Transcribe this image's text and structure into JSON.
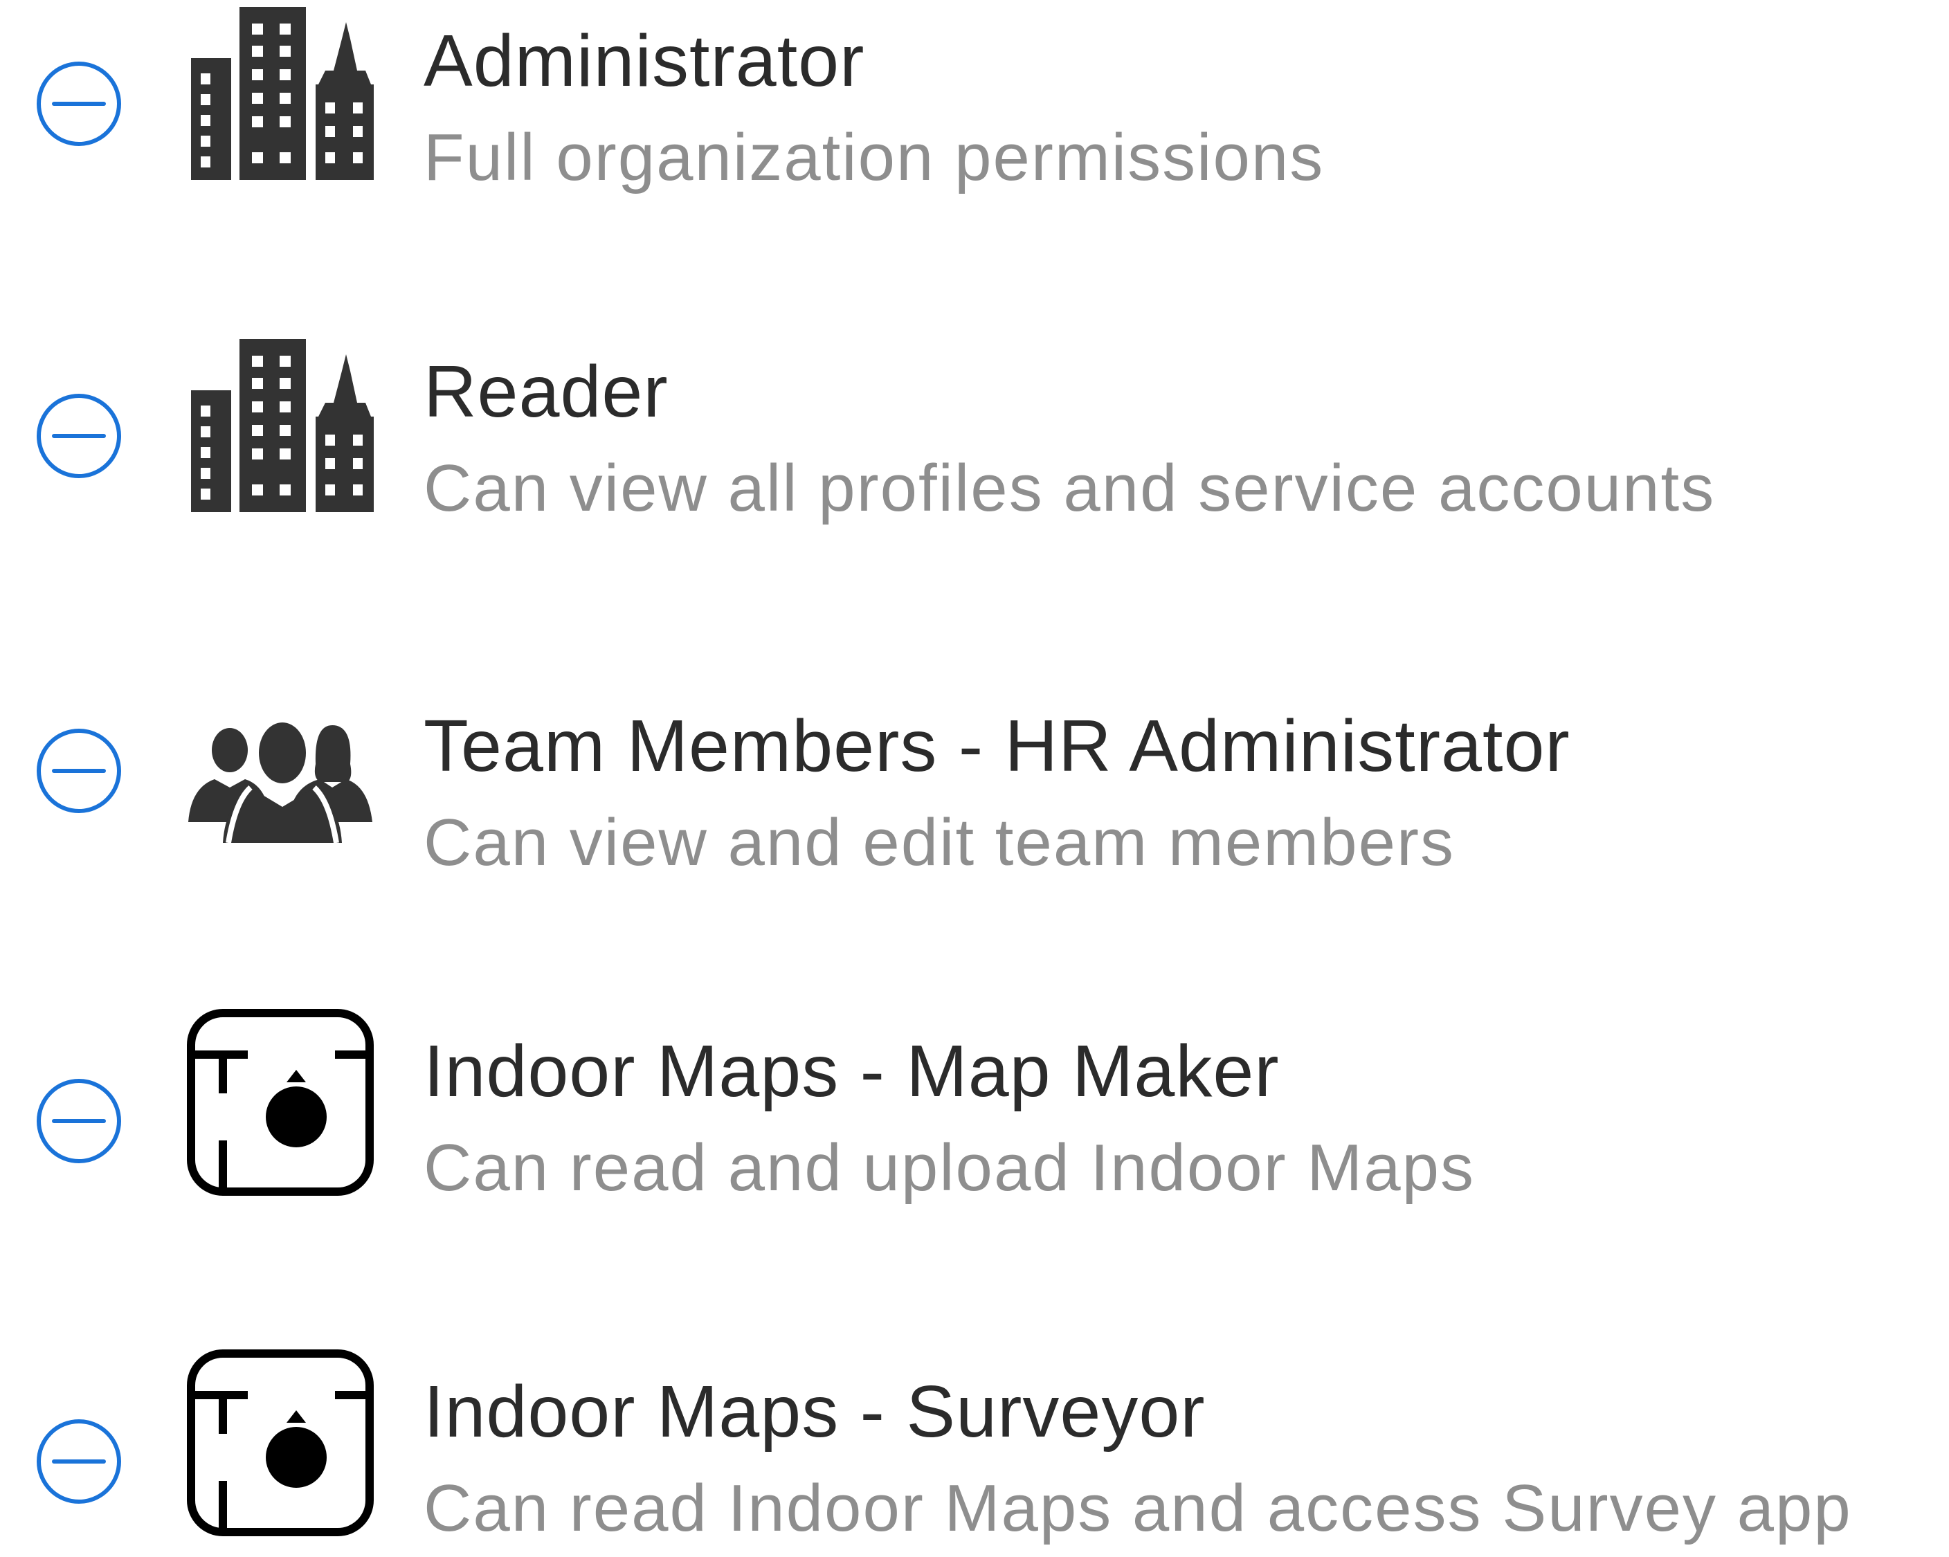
{
  "accent_color": "#1a73d9",
  "icon_color": "#333333",
  "roles": [
    {
      "title": "Administrator",
      "description": "Full organization permissions",
      "icon": "buildings-icon"
    },
    {
      "title": "Reader",
      "description": "Can view all profiles and service accounts",
      "icon": "buildings-icon"
    },
    {
      "title": "Team Members - HR Administrator",
      "description": "Can view and edit team members",
      "icon": "people-group-icon"
    },
    {
      "title": "Indoor Maps - Map Maker",
      "description": "Can read and upload Indoor Maps",
      "icon": "indoor-map-icon"
    },
    {
      "title": "Indoor Maps - Surveyor",
      "description": "Can read Indoor Maps and access Survey app",
      "icon": "indoor-map-icon"
    }
  ]
}
